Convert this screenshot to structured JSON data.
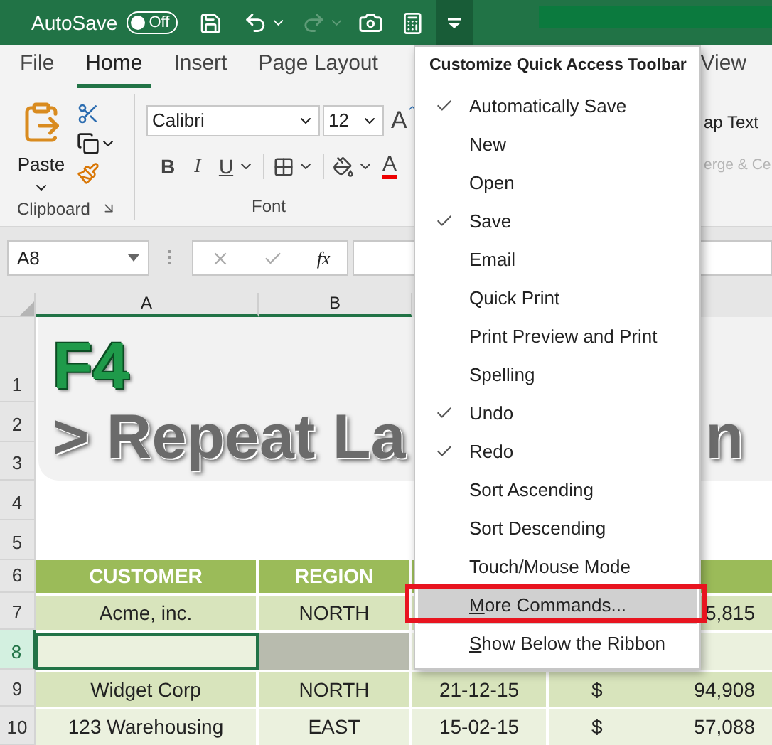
{
  "title_bar": {
    "autosave_label": "AutoSave",
    "autosave_toggle": {
      "on": false,
      "label": "Off"
    },
    "redo_disabled": true
  },
  "tabs": [
    {
      "label": "File",
      "selected": false
    },
    {
      "label": "Home",
      "selected": true
    },
    {
      "label": "Insert",
      "selected": false
    },
    {
      "label": "Page Layout",
      "selected": false
    }
  ],
  "tabs_right": [
    {
      "label": "View",
      "selected": false
    }
  ],
  "ribbon": {
    "clipboard": {
      "paste_label": "Paste",
      "group_label": "Clipboard"
    },
    "font": {
      "font_name": "Calibri",
      "font_size": "12",
      "grow_font": "A",
      "bold": "B",
      "italic": "I",
      "underline": "U",
      "font_color": "A",
      "group_label": "Font"
    },
    "alignment": {
      "wrap_text": "ap Text",
      "merge": "erge & Ce",
      "merge_disabled": true
    }
  },
  "formula_bar": {
    "name_box": "A8",
    "fx": "fx"
  },
  "sheet": {
    "columns": [
      "A",
      "B"
    ],
    "row_headers": [
      {
        "label": "1",
        "selected": false
      },
      {
        "label": "2",
        "selected": false
      },
      {
        "label": "3",
        "selected": false
      },
      {
        "label": "4",
        "selected": false
      },
      {
        "label": "5",
        "selected": false
      },
      {
        "label": "6",
        "selected": false
      },
      {
        "label": "7",
        "selected": false
      },
      {
        "label": "8",
        "selected": true
      },
      {
        "label": "9",
        "selected": false
      },
      {
        "label": "10",
        "selected": false
      }
    ],
    "banner": {
      "key": "F4",
      "text_left": "> Repeat La",
      "text_right": "n"
    },
    "table": {
      "header": [
        "CUSTOMER",
        "REGION"
      ],
      "rows": [
        {
          "selected": false,
          "customer": "Acme, inc.",
          "region": "NORTH",
          "amount": "5,815"
        },
        {
          "selected": true
        },
        {
          "selected": false,
          "customer": "Widget Corp",
          "region": "NORTH",
          "date": "21-12-15",
          "currency": "$",
          "amount": "94,908"
        },
        {
          "selected": false,
          "customer": "123 Warehousing",
          "region": "EAST",
          "date": "15-02-15",
          "currency": "$",
          "amount": "57,088"
        }
      ]
    }
  },
  "menu": {
    "title": "Customize Quick Access Toolbar",
    "items": [
      {
        "label": "Automatically Save",
        "checked": true,
        "highlighted": false,
        "underline_first": false
      },
      {
        "label": "New",
        "checked": false,
        "highlighted": false,
        "underline_first": false
      },
      {
        "label": "Open",
        "checked": false,
        "highlighted": false,
        "underline_first": false
      },
      {
        "label": "Save",
        "checked": true,
        "highlighted": false,
        "underline_first": false
      },
      {
        "label": "Email",
        "checked": false,
        "highlighted": false,
        "underline_first": false
      },
      {
        "label": "Quick Print",
        "checked": false,
        "highlighted": false,
        "underline_first": false
      },
      {
        "label": "Print Preview and Print",
        "checked": false,
        "highlighted": false,
        "underline_first": false
      },
      {
        "label": "Spelling",
        "checked": false,
        "highlighted": false,
        "underline_first": false
      },
      {
        "label": "Undo",
        "checked": true,
        "highlighted": false,
        "underline_first": false
      },
      {
        "label": "Redo",
        "checked": true,
        "highlighted": false,
        "underline_first": false
      },
      {
        "label": "Sort Ascending",
        "checked": false,
        "highlighted": false,
        "underline_first": false
      },
      {
        "label": "Sort Descending",
        "checked": false,
        "highlighted": false,
        "underline_first": false
      },
      {
        "label": "Touch/Mouse Mode",
        "checked": false,
        "highlighted": false,
        "underline_first": false
      },
      {
        "label": "More Commands...",
        "checked": false,
        "highlighted": true,
        "underline_first": true
      },
      {
        "label": "Show Below the Ribbon",
        "checked": false,
        "highlighted": false,
        "underline_first": true
      }
    ]
  }
}
